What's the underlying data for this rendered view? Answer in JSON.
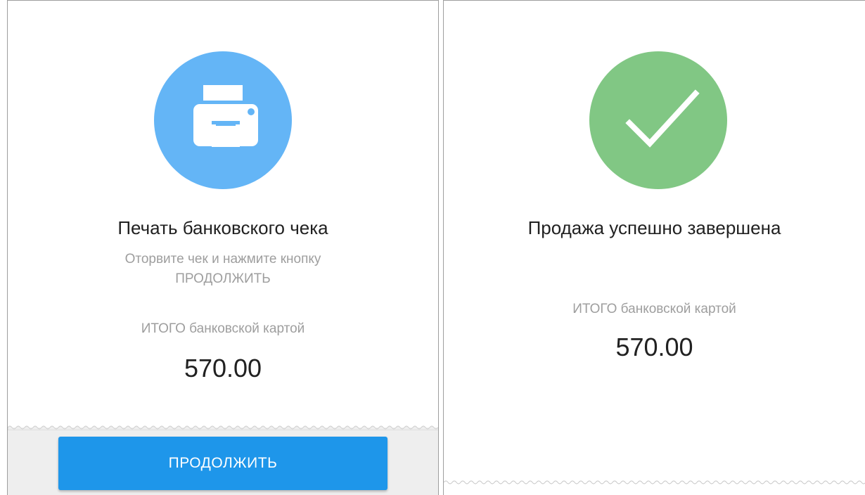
{
  "print_receipt": {
    "title": "Печать банковского чека",
    "instruction_line1": "Оторвите чек и нажмите кнопку",
    "instruction_line2": "ПРОДОЛЖИТЬ",
    "total_label": "ИТОГО банковской картой",
    "total_amount": "570.00",
    "continue_button": "ПРОДОЛЖИТЬ",
    "icon": "printer-icon",
    "icon_bg_color": "#64b5f6"
  },
  "sale_complete": {
    "title": "Продажа успешно завершена",
    "total_label": "ИТОГО банковской картой",
    "total_amount": "570.00",
    "icon": "checkmark-icon",
    "icon_bg_color": "#81c784"
  },
  "colors": {
    "button": "#1e96ea",
    "footer_bg": "#eeeeee"
  }
}
